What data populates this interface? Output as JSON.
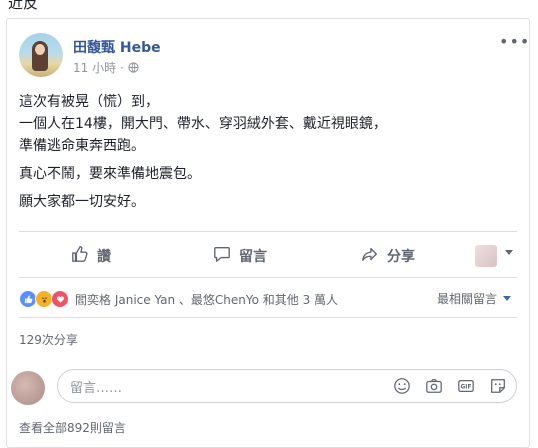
{
  "top_fragment": "近反",
  "post": {
    "author": "田馥甄 Hebe",
    "time": "11 小時",
    "dot": "·",
    "paragraphs": [
      "這次有被晃（慌）到，\n一個人在14樓，開大門、帶水、穿羽絨外套、戴近視眼鏡，\n準備逃命東奔西跑。",
      "真心不鬧，要來準備地震包。",
      "願大家都一切安好。"
    ]
  },
  "actions": {
    "like": "讚",
    "comment": "留言",
    "share": "分享"
  },
  "reactions": {
    "names": "閻奕格 Janice Yan 、最悠ChenYo 和其他 3 萬人",
    "sort_label": "最相關留言"
  },
  "shares": "129次分享",
  "comment_box": {
    "placeholder": "留言……"
  },
  "view_all": "查看全部892則留言",
  "colors": {
    "link_blue": "#365899",
    "meta_gray": "#90949c",
    "action_gray": "#606770"
  }
}
